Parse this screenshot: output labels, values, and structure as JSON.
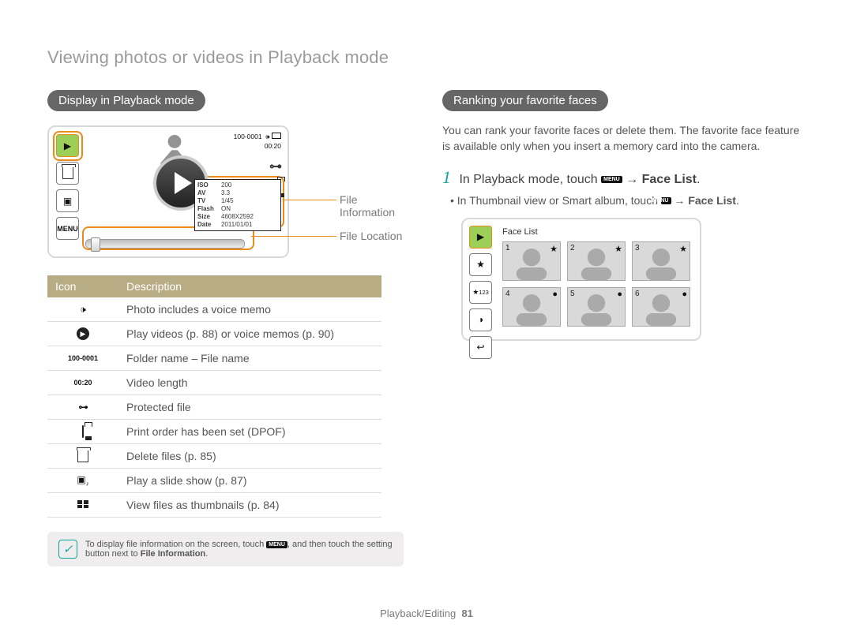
{
  "pageTitle": "Viewing photos or videos in Playback mode",
  "left": {
    "heading": "Display in Playback mode",
    "callouts": {
      "fileInfo": "File Information",
      "fileLoc": "File Location"
    },
    "screen": {
      "folder": "100-0001",
      "time": "00:20",
      "menu": "MENU",
      "info": {
        "iso_k": "ISO",
        "iso_v": "200",
        "av_k": "AV",
        "av_v": "3.3",
        "tv_k": "TV",
        "tv_v": "1/45",
        "flash_k": "Flash",
        "flash_v": "ON",
        "size_k": "Size",
        "size_v": "4608X2592",
        "date_k": "Date",
        "date_v": "2011/01/01"
      }
    },
    "table": {
      "headIcon": "Icon",
      "headDesc": "Description",
      "rows": [
        {
          "icon": "voice-memo-icon",
          "desc": "Photo includes a voice memo"
        },
        {
          "icon": "play-icon",
          "desc": "Play videos (p. 88) or voice memos (p. 90)"
        },
        {
          "icon": "100-0001",
          "desc": "Folder name – File name"
        },
        {
          "icon": "00:20",
          "desc": "Video length"
        },
        {
          "icon": "key-icon",
          "desc": "Protected file"
        },
        {
          "icon": "printer-icon",
          "desc": "Print order has been set (DPOF)"
        },
        {
          "icon": "trash-icon",
          "desc": "Delete files (p. 85)"
        },
        {
          "icon": "slideshow-icon",
          "desc": "Play a slide show (p. 87)"
        },
        {
          "icon": "thumbnails-icon",
          "desc": "View files as thumbnails (p. 84)"
        }
      ]
    },
    "tip": {
      "pre": "To display file information on the screen, touch ",
      "menu": "MENU",
      "post": ", and then touch the setting button next to ",
      "bold": "File Information",
      "end": "."
    }
  },
  "right": {
    "heading": "Ranking your favorite faces",
    "para": "You can rank your favorite faces or delete them. The favorite face feature is available only when you insert a memory card into the camera.",
    "step1_pre": "In Playback mode, touch ",
    "step1_menu": "MENU",
    "step1_arrow": " → ",
    "step1_bold": "Face List",
    "step1_end": ".",
    "bullet_pre": "In Thumbnail view or Smart album, touch ",
    "bullet_bold": "Face List",
    "facelist_label": "Face List",
    "nums": [
      "1",
      "2",
      "3",
      "4",
      "5",
      "6"
    ],
    "s2_icons_name": [
      "play-icon",
      "star-icon",
      "rank-icon",
      "edit-icon",
      "back-icon"
    ]
  },
  "footer": {
    "section": "Playback/Editing",
    "page": "81"
  }
}
